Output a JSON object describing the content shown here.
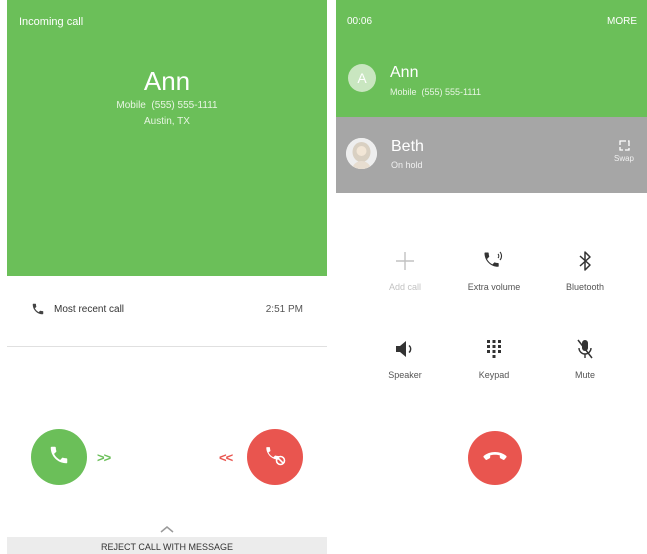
{
  "screen1": {
    "status": "Incoming call",
    "caller_name": "Ann",
    "caller_number": "Mobile  (555) 555-1111",
    "caller_location": "Austin, TX",
    "recent_label": "Most recent call",
    "recent_time": "2:51 PM",
    "reject_message_label": "REJECT CALL WITH MESSAGE",
    "accent_green": "#6bbf59",
    "accent_red": "#e9554f"
  },
  "screen2": {
    "timer": "00:06",
    "more_label": "MORE",
    "active_call": {
      "avatar_letter": "A",
      "name": "Ann",
      "number": "Mobile  (555) 555-1111"
    },
    "held_call": {
      "name": "Beth",
      "status": "On hold",
      "swap_label": "Swap"
    },
    "controls": [
      {
        "label": "Add call",
        "icon": "plus-icon",
        "enabled": false
      },
      {
        "label": "Extra volume",
        "icon": "phone-volume-icon",
        "enabled": true
      },
      {
        "label": "Bluetooth",
        "icon": "bluetooth-icon",
        "enabled": true
      },
      {
        "label": "Speaker",
        "icon": "speaker-icon",
        "enabled": true
      },
      {
        "label": "Keypad",
        "icon": "keypad-icon",
        "enabled": true
      },
      {
        "label": "Mute",
        "icon": "mute-icon",
        "enabled": true
      }
    ]
  }
}
